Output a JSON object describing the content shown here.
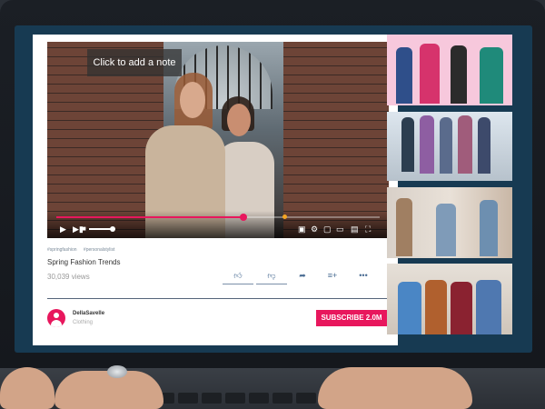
{
  "video": {
    "note_tip": "Click to add a note",
    "progress_fraction": 0.58,
    "volume_fraction": 1.0
  },
  "video_info": {
    "tags": [
      "#springfashion",
      "#personalstylist"
    ],
    "title": "Spring Fashion Trends",
    "views": "30,039 views"
  },
  "actions": {
    "like_icon": "thumbs-up-icon",
    "dislike_icon": "thumbs-down-icon",
    "share_icon": "share-icon",
    "playlist_icon": "add-to-playlist-icon",
    "more_icon": "more-icon",
    "more_glyph": "•••"
  },
  "channel": {
    "name": "DellaSavelle",
    "category": "Clothing",
    "subscribe_label": "SUBSCRIBE 2.0M"
  },
  "colors": {
    "accent": "#e8175d",
    "action_icons": "#4a6c93",
    "thumb1_bg": "#f7c8dc"
  },
  "sidebar": {
    "thumbnails": [
      "fashion-lineup-pink",
      "runway-walk",
      "street-style-collage",
      "group-in-coats"
    ]
  }
}
